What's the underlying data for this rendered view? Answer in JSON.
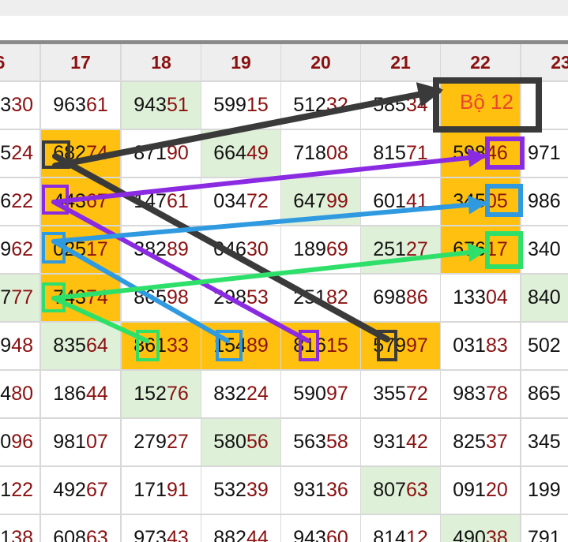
{
  "colors": {
    "black": "#3a3a3a",
    "purple": "#8a2be2",
    "blue": "#2f9ae0",
    "green": "#2ee06a",
    "orange": "#ffc00f",
    "highlight": "#dff0d8",
    "number_accent": "#8b1010"
  },
  "table": {
    "headers": [
      "6",
      "17",
      "18",
      "19",
      "20",
      "21",
      "22",
      "23"
    ],
    "rows": [
      [
        {
          "a": "3",
          "b": "30"
        },
        {
          "a": "963",
          "b": "61"
        },
        {
          "a": "943",
          "b": "51",
          "bg": "green"
        },
        {
          "a": "599",
          "b": "15"
        },
        {
          "a": "512",
          "b": "32"
        },
        {
          "a": "585",
          "b": "34"
        },
        {
          "a": "",
          "b": "",
          "bg": "orange"
        },
        {
          "a": "",
          "b": ""
        }
      ],
      [
        {
          "a": "5",
          "b": "24"
        },
        {
          "a": "682",
          "b": "74",
          "bg": "orange"
        },
        {
          "a": "871",
          "b": "90"
        },
        {
          "a": "664",
          "b": "49",
          "bg": "green"
        },
        {
          "a": "718",
          "b": "08"
        },
        {
          "a": "815",
          "b": "71"
        },
        {
          "a": "598",
          "b": "46",
          "bg": "orange"
        },
        {
          "a": "971",
          "b": ""
        }
      ],
      [
        {
          "a": "6",
          "b": "22"
        },
        {
          "a": "443",
          "b": "67",
          "bg": "orange"
        },
        {
          "a": "147",
          "b": "61"
        },
        {
          "a": "034",
          "b": "72"
        },
        {
          "a": "647",
          "b": "99",
          "bg": "green"
        },
        {
          "a": "601",
          "b": "41"
        },
        {
          "a": "345",
          "b": "05",
          "bg": "orange"
        },
        {
          "a": "986",
          "b": ""
        }
      ],
      [
        {
          "a": "9",
          "b": "62"
        },
        {
          "a": "025",
          "b": "17",
          "bg": "orange"
        },
        {
          "a": "382",
          "b": "89"
        },
        {
          "a": "046",
          "b": "30"
        },
        {
          "a": "189",
          "b": "69"
        },
        {
          "a": "251",
          "b": "27",
          "bg": "green"
        },
        {
          "a": "676",
          "b": "17",
          "bg": "orange"
        },
        {
          "a": "340",
          "b": ""
        }
      ],
      [
        {
          "a": "7",
          "b": "77",
          "bg": "green"
        },
        {
          "a": "743",
          "b": "74",
          "bg": "orange"
        },
        {
          "a": "865",
          "b": "98"
        },
        {
          "a": "298",
          "b": "53"
        },
        {
          "a": "251",
          "b": "82"
        },
        {
          "a": "698",
          "b": "86"
        },
        {
          "a": "133",
          "b": "04"
        },
        {
          "a": "840",
          "b": "",
          "bg": "green"
        }
      ],
      [
        {
          "a": "9",
          "b": "48"
        },
        {
          "a": "835",
          "b": "64",
          "bg": "green"
        },
        {
          "a": "861",
          "b": "33",
          "bg": "orange"
        },
        {
          "a": "154",
          "b": "89",
          "bg": "orange"
        },
        {
          "a": "816",
          "b": "15",
          "bg": "orange"
        },
        {
          "a": "579",
          "b": "97",
          "bg": "orange"
        },
        {
          "a": "031",
          "b": "83"
        },
        {
          "a": "502",
          "b": ""
        }
      ],
      [
        {
          "a": "4",
          "b": "80"
        },
        {
          "a": "186",
          "b": "44"
        },
        {
          "a": "152",
          "b": "76",
          "bg": "green"
        },
        {
          "a": "832",
          "b": "24"
        },
        {
          "a": "590",
          "b": "97"
        },
        {
          "a": "355",
          "b": "72"
        },
        {
          "a": "983",
          "b": "78"
        },
        {
          "a": "865",
          "b": ""
        }
      ],
      [
        {
          "a": "0",
          "b": "96"
        },
        {
          "a": "981",
          "b": "07"
        },
        {
          "a": "279",
          "b": "27"
        },
        {
          "a": "580",
          "b": "56",
          "bg": "green"
        },
        {
          "a": "563",
          "b": "58"
        },
        {
          "a": "931",
          "b": "42"
        },
        {
          "a": "825",
          "b": "37"
        },
        {
          "a": "345",
          "b": ""
        }
      ],
      [
        {
          "a": "1",
          "b": "22"
        },
        {
          "a": "492",
          "b": "67"
        },
        {
          "a": "171",
          "b": "91"
        },
        {
          "a": "532",
          "b": "39"
        },
        {
          "a": "931",
          "b": "36"
        },
        {
          "a": "807",
          "b": "63",
          "bg": "green"
        },
        {
          "a": "091",
          "b": "20"
        },
        {
          "a": "199",
          "b": ""
        }
      ],
      [
        {
          "a": "1",
          "b": "38"
        },
        {
          "a": "608",
          "b": "63"
        },
        {
          "a": "973",
          "b": "43"
        },
        {
          "a": "882",
          "b": "44"
        },
        {
          "a": "943",
          "b": "60"
        },
        {
          "a": "814",
          "b": "12"
        },
        {
          "a": "490",
          "b": "38",
          "bg": "green"
        },
        {
          "a": "791",
          "b": ""
        }
      ]
    ]
  },
  "annotation": {
    "label": "Bộ 12"
  }
}
